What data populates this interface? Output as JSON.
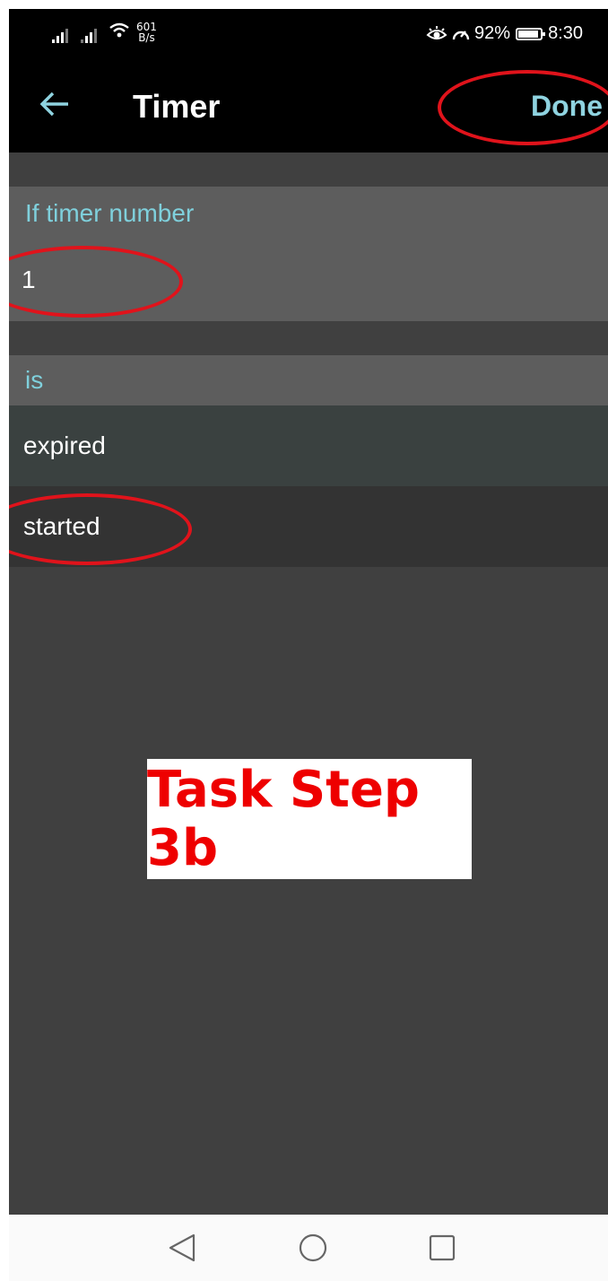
{
  "status_bar": {
    "net_speed_value": "601",
    "net_speed_unit": "B/s",
    "battery_percent": "92%",
    "battery_level": 0.92,
    "time": "8:30"
  },
  "app_bar": {
    "title": "Timer",
    "done_label": "Done"
  },
  "timer_number": {
    "label": "If timer number",
    "value": "1"
  },
  "state": {
    "label": "is",
    "options": [
      "expired",
      "started"
    ]
  },
  "annotation": {
    "text": "Task Step 3b"
  },
  "colors": {
    "accent": "#7fd0dc",
    "highlight_ellipse": "#e0131b",
    "annotation_text": "#ee0000"
  },
  "icons": {
    "back": "back-arrow-icon",
    "nav_back": "triangle-back-icon",
    "nav_home": "circle-home-icon",
    "nav_recents": "square-recents-icon"
  }
}
